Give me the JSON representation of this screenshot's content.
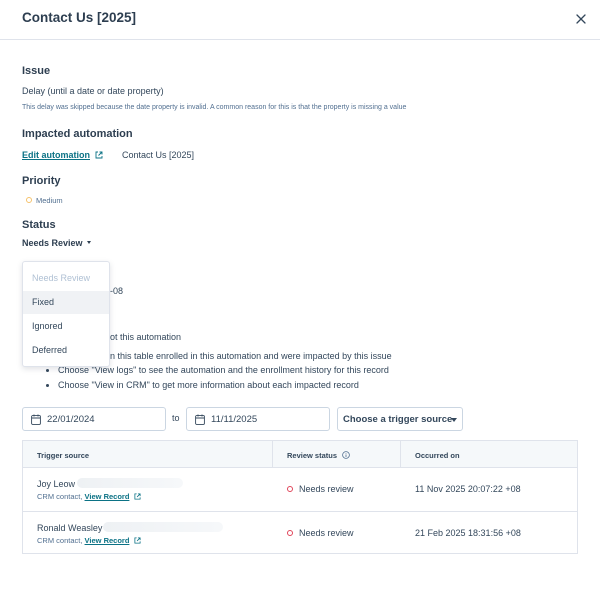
{
  "header": {
    "title": "Contact Us [2025]"
  },
  "issue": {
    "heading": "Issue",
    "title": "Delay (until a date or date property)",
    "description": "This delay was skipped because the date property is invalid. A common reason for this is that the property is missing a value"
  },
  "automation": {
    "heading": "Impacted automation",
    "edit_link": "Edit automation",
    "name": "Contact Us [2025]"
  },
  "priority": {
    "heading": "Priority",
    "value": "Medium",
    "color": "#f5c26b"
  },
  "status": {
    "heading": "Status",
    "current": "Needs Review",
    "menu": [
      {
        "label": "Needs Review",
        "disabled": true
      },
      {
        "label": "Fixed",
        "hover": true
      },
      {
        "label": "Ignored"
      },
      {
        "label": "Deferred"
      }
    ]
  },
  "obscured": {
    "partial_text_1": "-08",
    "partial_text_2": "ot this automation",
    "partial_text_3": "n this table enrolled in this automation and were impacted by this issue"
  },
  "instructions": [
    "Choose \"View logs\" to see the automation and the enrollment history for this record",
    "Choose \"View in CRM\" to get more information about each impacted record"
  ],
  "filters": {
    "start_date": "22/01/2024",
    "to_label": "to",
    "end_date": "11/11/2025",
    "trigger_button": "Choose a trigger source"
  },
  "table": {
    "columns": [
      "Trigger source",
      "Review status",
      "Occurred on"
    ],
    "rows": [
      {
        "name": "Joy Leow",
        "type": "CRM contact,",
        "link": "View Record",
        "status": "Needs review",
        "occurred": "11 Nov 2025 20:07:22 +08"
      },
      {
        "name": "Ronald Weasley",
        "type": "CRM contact,",
        "link": "View Record",
        "status": "Needs review",
        "occurred": "21 Feb 2025 18:31:56 +08"
      }
    ]
  }
}
